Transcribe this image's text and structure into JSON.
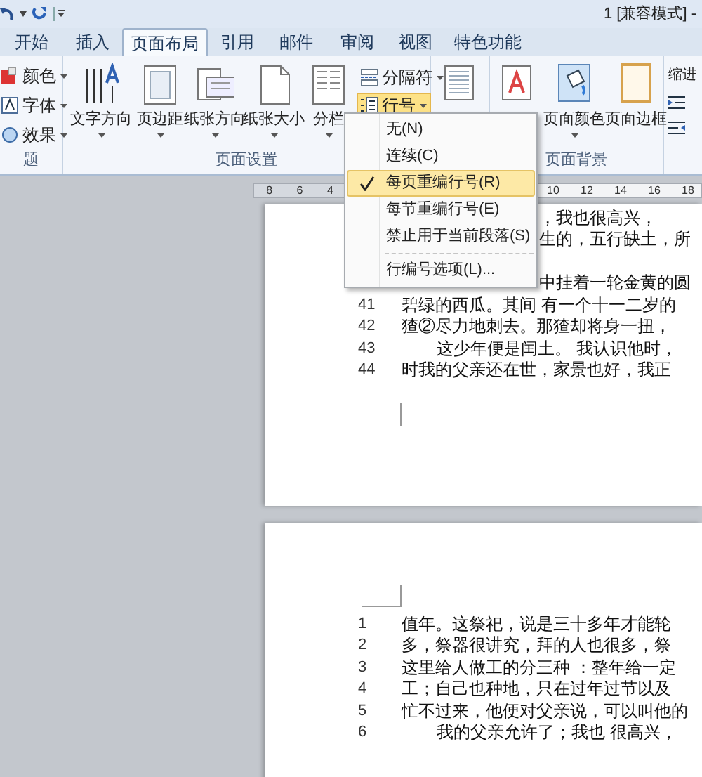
{
  "title_bar": {
    "title": "1 [兼容模式] -"
  },
  "tabs": [
    {
      "label": "开始",
      "selected": false
    },
    {
      "label": "插入",
      "selected": false
    },
    {
      "label": "页面布局",
      "selected": true
    },
    {
      "label": "引用",
      "selected": false
    },
    {
      "label": "邮件",
      "selected": false
    },
    {
      "label": "审阅",
      "selected": false
    },
    {
      "label": "视图",
      "selected": false
    },
    {
      "label": "特色功能",
      "selected": false
    }
  ],
  "ribbon": {
    "theme_group": {
      "label": "题",
      "items": [
        {
          "label": "颜色"
        },
        {
          "label": "字体"
        },
        {
          "label": "效果"
        }
      ]
    },
    "page_setup": {
      "label": "页面设置",
      "large_buttons": [
        {
          "label": "文字方向"
        },
        {
          "label": "页边距"
        },
        {
          "label": "纸张方向"
        },
        {
          "label": "纸张大小"
        },
        {
          "label": "分栏"
        }
      ],
      "small_buttons": [
        {
          "label": "分隔符",
          "highlighted": false
        },
        {
          "label": "行号",
          "highlighted": true
        }
      ]
    },
    "page_background": {
      "label": "页面背景",
      "buttons": [
        {
          "label": "页面颜色"
        },
        {
          "label": "页面边框"
        }
      ]
    },
    "paragraph": {
      "label": "缩进"
    }
  },
  "line_numbers_menu": {
    "items": [
      {
        "label": "无(N)",
        "selected": false
      },
      {
        "label": "连续(C)",
        "selected": false
      },
      {
        "label": "每页重编行号(R)",
        "selected": true
      },
      {
        "label": "每节重编行号(E)",
        "selected": false
      },
      {
        "label": "禁止用于当前段落(S)",
        "selected": false
      },
      {
        "label": "行编号选项(L)...",
        "selected": false,
        "separator_before": true
      }
    ]
  },
  "ruler": {
    "left_ticks": [
      "8",
      "6",
      "4"
    ],
    "right_ticks": [
      "10",
      "12",
      "14",
      "16",
      "18"
    ]
  },
  "pages": [
    {
      "lines": [
        {
          "kind": "partial",
          "text": "，我也很高兴，"
        },
        {
          "kind": "partial",
          "text": "生的，五行缺土，所"
        },
        {
          "kind": "blank"
        },
        {
          "kind": "partial",
          "text": "中挂着一轮金黄的圆"
        },
        {
          "kind": "numbered",
          "number": "41",
          "text": "碧绿的西瓜。其间 有一个十一二岁的"
        },
        {
          "kind": "numbered",
          "number": "42",
          "text": "猹②尽力地刺去。那猹却将身一扭，"
        },
        {
          "kind": "numbered",
          "number": "43",
          "text": "这少年便是闰土。 我认识他时，",
          "indent": true
        },
        {
          "kind": "numbered",
          "number": "44",
          "text": "时我的父亲还在世，家景也好，我正"
        }
      ]
    },
    {
      "lines": [
        {
          "kind": "numbered",
          "number": "1",
          "text": "值年。这祭祀，说是三十多年才能轮"
        },
        {
          "kind": "numbered",
          "number": "2",
          "text": "多，祭器很讲究，拜的人也很多，祭"
        },
        {
          "kind": "numbered",
          "number": "3",
          "text": "这里给人做工的分三种 ：整年给一定"
        },
        {
          "kind": "numbered",
          "number": "4",
          "text": "工；自己也种地，只在过年过节以及"
        },
        {
          "kind": "numbered",
          "number": "5",
          "text": "忙不过来，他便对父亲说，可以叫他的"
        },
        {
          "kind": "numbered",
          "number": "6",
          "text": "我的父亲允许了；我也 很高兴，",
          "indent": true
        }
      ]
    }
  ]
}
